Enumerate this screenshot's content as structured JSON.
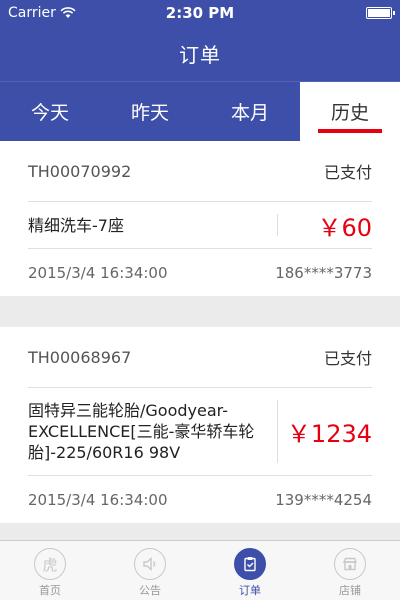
{
  "status_bar": {
    "carrier": "Carrier",
    "time": "2:30 PM"
  },
  "header": {
    "title": "订单"
  },
  "tabs": [
    {
      "label": "今天",
      "active": false
    },
    {
      "label": "昨天",
      "active": false
    },
    {
      "label": "本月",
      "active": false
    },
    {
      "label": "历史",
      "active": true
    }
  ],
  "orders": [
    {
      "id": "TH00070992",
      "status": "已支付",
      "item": "精细洗车-7座",
      "price": "￥60",
      "datetime": "2015/3/4 16:34:00",
      "phone": "186****3773"
    },
    {
      "id": "TH00068967",
      "status": "已支付",
      "item": "固特异三能轮胎/Goodyear-EXCELLENCE[三能-豪华轿车轮胎]-225/60R16 98V",
      "price": "￥1234",
      "datetime": "2015/3/4 16:34:00",
      "phone": "139****4254"
    }
  ],
  "tabbar": [
    {
      "label": "首页",
      "icon": "tiger-icon",
      "glyph": "虎",
      "active": false
    },
    {
      "label": "公告",
      "icon": "speaker-icon",
      "glyph": "",
      "active": false
    },
    {
      "label": "订单",
      "icon": "clipboard-icon",
      "glyph": "",
      "active": true
    },
    {
      "label": "店铺",
      "icon": "shop-icon",
      "glyph": "",
      "active": false
    }
  ],
  "colors": {
    "primary": "#3d4fa8",
    "accent": "#e60012"
  }
}
